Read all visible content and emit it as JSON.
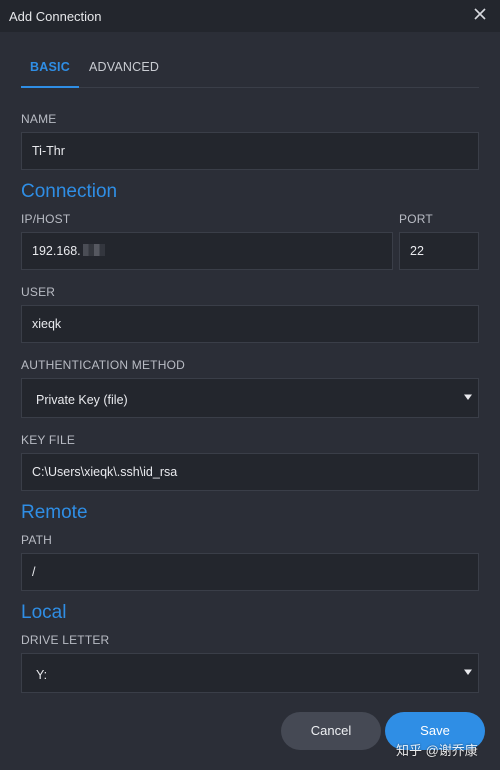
{
  "window": {
    "title": "Add Connection",
    "close_icon": "close-icon"
  },
  "tabs": [
    {
      "label": "BASIC",
      "active": true
    },
    {
      "label": "ADVANCED",
      "active": false
    }
  ],
  "name": {
    "label": "NAME",
    "value": "Ti-Thr"
  },
  "sections": {
    "connection": "Connection",
    "remote": "Remote",
    "local": "Local"
  },
  "host": {
    "label": "IP/HOST",
    "value": "192.168."
  },
  "port": {
    "label": "PORT",
    "value": "22"
  },
  "user": {
    "label": "USER",
    "value": "xieqk"
  },
  "auth": {
    "label": "AUTHENTICATION METHOD",
    "selected": "Private Key (file)"
  },
  "key_file": {
    "label": "KEY FILE",
    "value": "C:\\Users\\xieqk\\.ssh\\id_rsa"
  },
  "path": {
    "label": "PATH",
    "value": "/"
  },
  "drive": {
    "label": "DRIVE LETTER",
    "selected": "Y:"
  },
  "buttons": {
    "cancel": "Cancel",
    "save": "Save"
  },
  "watermark": "知乎 @谢乔康",
  "colors": {
    "accent": "#2f8ee5",
    "background": "#2b2e37",
    "input_bg": "#23262d",
    "cancel_bg": "#454954"
  }
}
